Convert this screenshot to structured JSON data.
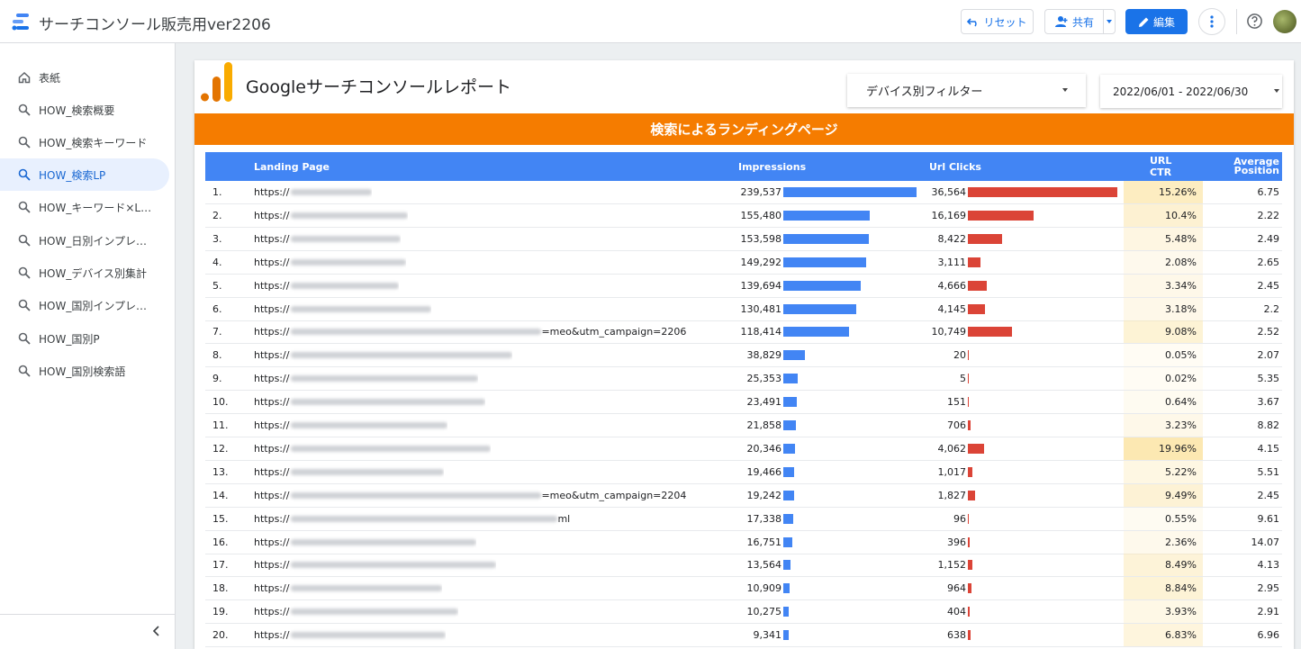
{
  "app": {
    "title": "サーチコンソール販売用ver2206"
  },
  "toolbar": {
    "reset_label": "リセット",
    "share_label": "共有",
    "edit_label": "編集"
  },
  "sidebar": {
    "items": [
      {
        "label": "表紙",
        "icon": "home-icon",
        "active": false
      },
      {
        "label": "HOW_検索概要",
        "icon": "search-icon",
        "active": false
      },
      {
        "label": "HOW_検索キーワード",
        "icon": "search-icon",
        "active": false
      },
      {
        "label": "HOW_検索LP",
        "icon": "search-icon",
        "active": true
      },
      {
        "label": "HOW_キーワード×LP集計",
        "icon": "search-icon",
        "active": false
      },
      {
        "label": "HOW_日別インプレッシ...",
        "icon": "search-icon",
        "active": false
      },
      {
        "label": "HOW_デバイス別集計",
        "icon": "search-icon",
        "active": false
      },
      {
        "label": "HOW_国別インプレッシ...",
        "icon": "search-icon",
        "active": false
      },
      {
        "label": "HOW_国別P",
        "icon": "search-icon",
        "active": false
      },
      {
        "label": "HOW_国別検索語",
        "icon": "search-icon",
        "active": false
      }
    ]
  },
  "report": {
    "title": "Googleサーチコンソールレポート",
    "device_filter": "デバイス別フィルター",
    "date_range": "2022/06/01 - 2022/06/30",
    "banner": "検索によるランディングページ"
  },
  "table": {
    "headers": {
      "landing_page": "Landing Page",
      "impressions": "Impressions",
      "clicks": "Url Clicks",
      "ctr": "URL CTR",
      "position_1": "Average",
      "position_2": "Position"
    },
    "colors": {
      "impressions_bar": "#4285f4",
      "clicks_bar": "#db4437",
      "ctr_heat": "#fce8b2"
    },
    "max_impressions": 239537,
    "max_clicks": 36564,
    "rows": [
      {
        "idx": "1.",
        "url_prefix": "https://",
        "url_suffix": "",
        "impressions": "239,537",
        "imp": 239537,
        "clicks": "36,564",
        "clk": 36564,
        "ctr": "15.26%",
        "ctr_val": 15.26,
        "position": "6.75"
      },
      {
        "idx": "2.",
        "url_prefix": "https://",
        "url_suffix": "",
        "impressions": "155,480",
        "imp": 155480,
        "clicks": "16,169",
        "clk": 16169,
        "ctr": "10.4%",
        "ctr_val": 10.4,
        "position": "2.22"
      },
      {
        "idx": "3.",
        "url_prefix": "https://",
        "url_suffix": "",
        "impressions": "153,598",
        "imp": 153598,
        "clicks": "8,422",
        "clk": 8422,
        "ctr": "5.48%",
        "ctr_val": 5.48,
        "position": "2.49"
      },
      {
        "idx": "4.",
        "url_prefix": "https://",
        "url_suffix": "",
        "impressions": "149,292",
        "imp": 149292,
        "clicks": "3,111",
        "clk": 3111,
        "ctr": "2.08%",
        "ctr_val": 2.08,
        "position": "2.65"
      },
      {
        "idx": "5.",
        "url_prefix": "https://",
        "url_suffix": "",
        "impressions": "139,694",
        "imp": 139694,
        "clicks": "4,666",
        "clk": 4666,
        "ctr": "3.34%",
        "ctr_val": 3.34,
        "position": "2.45"
      },
      {
        "idx": "6.",
        "url_prefix": "https://",
        "url_suffix": "",
        "impressions": "130,481",
        "imp": 130481,
        "clicks": "4,145",
        "clk": 4145,
        "ctr": "3.18%",
        "ctr_val": 3.18,
        "position": "2.2"
      },
      {
        "idx": "7.",
        "url_prefix": "https://",
        "url_suffix": "=meo&utm_campaign=2206",
        "impressions": "118,414",
        "imp": 118414,
        "clicks": "10,749",
        "clk": 10749,
        "ctr": "9.08%",
        "ctr_val": 9.08,
        "position": "2.52"
      },
      {
        "idx": "8.",
        "url_prefix": "https://",
        "url_suffix": "",
        "impressions": "38,829",
        "imp": 38829,
        "clicks": "20",
        "clk": 20,
        "ctr": "0.05%",
        "ctr_val": 0.05,
        "position": "2.07"
      },
      {
        "idx": "9.",
        "url_prefix": "https://",
        "url_suffix": "",
        "impressions": "25,353",
        "imp": 25353,
        "clicks": "5",
        "clk": 5,
        "ctr": "0.02%",
        "ctr_val": 0.02,
        "position": "5.35"
      },
      {
        "idx": "10.",
        "url_prefix": "https://",
        "url_suffix": "",
        "impressions": "23,491",
        "imp": 23491,
        "clicks": "151",
        "clk": 151,
        "ctr": "0.64%",
        "ctr_val": 0.64,
        "position": "3.67"
      },
      {
        "idx": "11.",
        "url_prefix": "https://",
        "url_suffix": "",
        "impressions": "21,858",
        "imp": 21858,
        "clicks": "706",
        "clk": 706,
        "ctr": "3.23%",
        "ctr_val": 3.23,
        "position": "8.82"
      },
      {
        "idx": "12.",
        "url_prefix": "https://",
        "url_suffix": "",
        "impressions": "20,346",
        "imp": 20346,
        "clicks": "4,062",
        "clk": 4062,
        "ctr": "19.96%",
        "ctr_val": 19.96,
        "position": "4.15"
      },
      {
        "idx": "13.",
        "url_prefix": "https://",
        "url_suffix": "",
        "impressions": "19,466",
        "imp": 19466,
        "clicks": "1,017",
        "clk": 1017,
        "ctr": "5.22%",
        "ctr_val": 5.22,
        "position": "5.51"
      },
      {
        "idx": "14.",
        "url_prefix": "https://",
        "url_suffix": "=meo&utm_campaign=2204",
        "impressions": "19,242",
        "imp": 19242,
        "clicks": "1,827",
        "clk": 1827,
        "ctr": "9.49%",
        "ctr_val": 9.49,
        "position": "2.45"
      },
      {
        "idx": "15.",
        "url_prefix": "https://",
        "url_suffix": "ml",
        "impressions": "17,338",
        "imp": 17338,
        "clicks": "96",
        "clk": 96,
        "ctr": "0.55%",
        "ctr_val": 0.55,
        "position": "9.61"
      },
      {
        "idx": "16.",
        "url_prefix": "https://",
        "url_suffix": "",
        "impressions": "16,751",
        "imp": 16751,
        "clicks": "396",
        "clk": 396,
        "ctr": "2.36%",
        "ctr_val": 2.36,
        "position": "14.07"
      },
      {
        "idx": "17.",
        "url_prefix": "https://",
        "url_suffix": "",
        "impressions": "13,564",
        "imp": 13564,
        "clicks": "1,152",
        "clk": 1152,
        "ctr": "8.49%",
        "ctr_val": 8.49,
        "position": "4.13"
      },
      {
        "idx": "18.",
        "url_prefix": "https://",
        "url_suffix": "",
        "impressions": "10,909",
        "imp": 10909,
        "clicks": "964",
        "clk": 964,
        "ctr": "8.84%",
        "ctr_val": 8.84,
        "position": "2.95"
      },
      {
        "idx": "19.",
        "url_prefix": "https://",
        "url_suffix": "",
        "impressions": "10,275",
        "imp": 10275,
        "clicks": "404",
        "clk": 404,
        "ctr": "3.93%",
        "ctr_val": 3.93,
        "position": "2.91"
      },
      {
        "idx": "20.",
        "url_prefix": "https://",
        "url_suffix": "",
        "impressions": "9,341",
        "imp": 9341,
        "clicks": "638",
        "clk": 638,
        "ctr": "6.83%",
        "ctr_val": 6.83,
        "position": "6.96"
      }
    ]
  }
}
